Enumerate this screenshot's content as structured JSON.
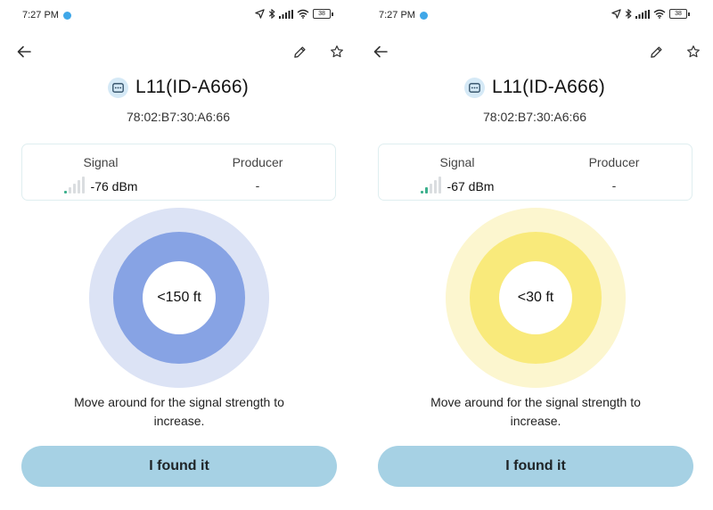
{
  "screens": [
    {
      "status": {
        "time": "7:27 PM",
        "battery": "38"
      },
      "device": {
        "name": "L11(ID-A666)",
        "mac": "78:02:B7:30:A6:66"
      },
      "info": {
        "signal_label": "Signal",
        "signal_value": "-76 dBm",
        "signal_bars_active": 1,
        "producer_label": "Producer",
        "producer_value": "-"
      },
      "proximity": {
        "distance": "<150 ft"
      },
      "hint": "Move around for the signal strength to increase.",
      "found_label": "I found it"
    },
    {
      "status": {
        "time": "7:27 PM",
        "battery": "38"
      },
      "device": {
        "name": "L11(ID-A666)",
        "mac": "78:02:B7:30:A6:66"
      },
      "info": {
        "signal_label": "Signal",
        "signal_value": "-67 dBm",
        "signal_bars_active": 2,
        "producer_label": "Producer",
        "producer_value": "-"
      },
      "proximity": {
        "distance": "<30 ft"
      },
      "hint": "Move around for the signal strength to increase.",
      "found_label": "I found it"
    }
  ],
  "colors": {
    "accent_button": "#a6d1e4",
    "ring_blue_outer": "#dce3f5",
    "ring_blue_mid": "#87a3e4",
    "ring_yellow_outer": "#fcf6cf",
    "ring_yellow_mid": "#f9ea7b",
    "signal_active": "#3cb08d",
    "signal_inactive": "#dadde0"
  },
  "icons": [
    "back-arrow-icon",
    "pencil-icon",
    "star-icon",
    "device-icon",
    "signal-bars-icon",
    "location-arrow-icon",
    "bluetooth-icon",
    "cell-signal-icon",
    "wifi-icon",
    "battery-icon"
  ]
}
